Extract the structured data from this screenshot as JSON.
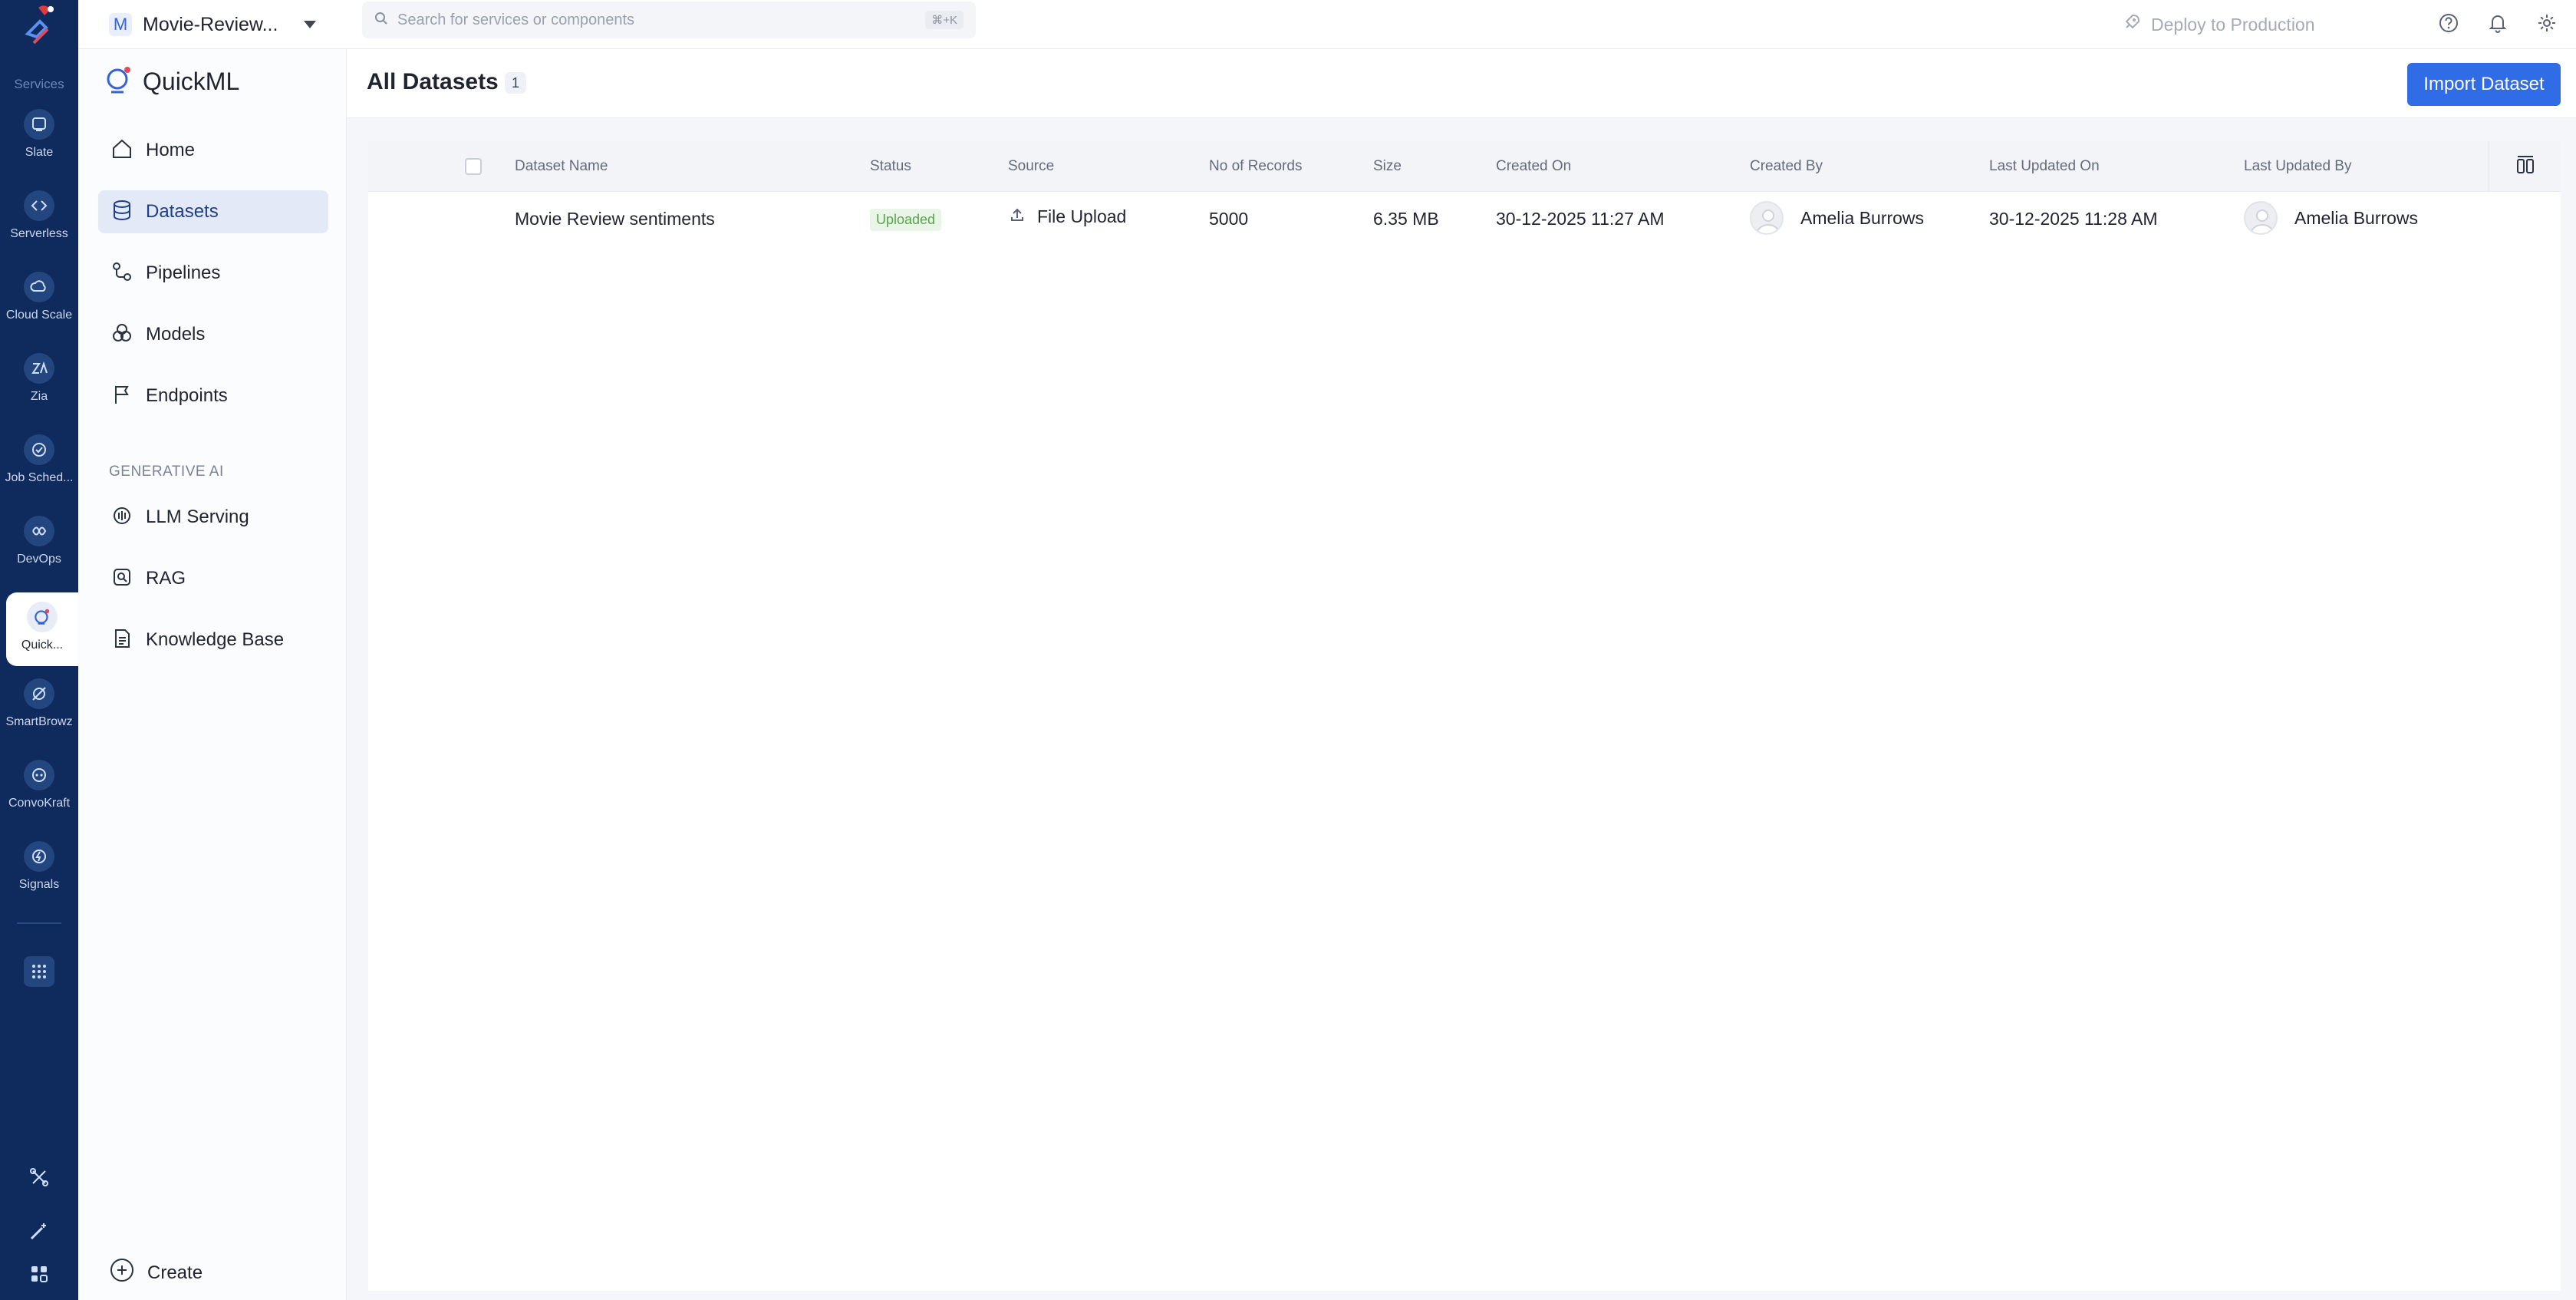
{
  "rail": {
    "services_label": "Services",
    "items": [
      {
        "label": "Slate",
        "icon": "slate-icon"
      },
      {
        "label": "Serverless",
        "icon": "serverless-icon"
      },
      {
        "label": "Cloud Scale",
        "icon": "cloud-scale-icon"
      },
      {
        "label": "Zia",
        "icon": "zia-icon"
      },
      {
        "label": "Job Sched...",
        "icon": "job-scheduling-icon"
      },
      {
        "label": "DevOps",
        "icon": "devops-icon"
      },
      {
        "label": "Quick...",
        "icon": "quickml-icon"
      },
      {
        "label": "SmartBrowz",
        "icon": "smartbrowz-icon"
      },
      {
        "label": "ConvoKraft",
        "icon": "convokraft-icon"
      },
      {
        "label": "Signals",
        "icon": "signals-icon"
      }
    ]
  },
  "topbar": {
    "project_initial": "M",
    "project_name": "Movie-Review...",
    "search_placeholder": "Search for services or components",
    "search_shortcut": "⌘+K",
    "deploy_label": "Deploy to Production"
  },
  "sidebar": {
    "brand": "QuickML",
    "nav": [
      {
        "label": "Home",
        "icon": "home-icon"
      },
      {
        "label": "Datasets",
        "icon": "database-icon"
      },
      {
        "label": "Pipelines",
        "icon": "pipeline-icon"
      },
      {
        "label": "Models",
        "icon": "models-icon"
      },
      {
        "label": "Endpoints",
        "icon": "flag-icon"
      }
    ],
    "section_label": "GENERATIVE AI",
    "gen_nav": [
      {
        "label": "LLM Serving",
        "icon": "llm-serving-icon"
      },
      {
        "label": "RAG",
        "icon": "rag-icon"
      },
      {
        "label": "Knowledge Base",
        "icon": "document-icon"
      }
    ],
    "create_label": "Create"
  },
  "main": {
    "title": "All Datasets",
    "count": "1",
    "import_button": "Import Dataset",
    "columns": [
      "Dataset Name",
      "Status",
      "Source",
      "No of Records",
      "Size",
      "Created On",
      "Created By",
      "Last Updated On",
      "Last Updated By"
    ],
    "rows": [
      {
        "name": "Movie Review sentiments",
        "status": "Uploaded",
        "source": "File Upload",
        "records": "5000",
        "size": "6.35 MB",
        "created_on": "30-12-2025 11:27 AM",
        "created_by": "Amelia Burrows",
        "updated_on": "30-12-2025 11:28 AM",
        "updated_by": "Amelia Burrows"
      }
    ]
  },
  "colors": {
    "rail_bg": "#0f2a5c",
    "accent": "#2f6ce5",
    "status_green": "#58a44a"
  }
}
